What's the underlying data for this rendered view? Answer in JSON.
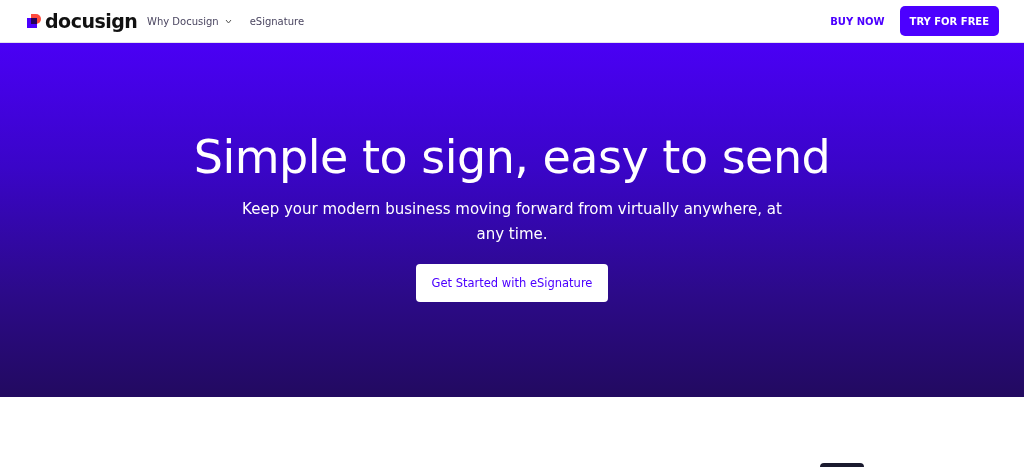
{
  "header": {
    "logo": "docusign",
    "nav": [
      {
        "label": "Why Docusign",
        "kind": "dropdown",
        "expanded": false
      },
      {
        "label": "eSignature",
        "kind": "link"
      }
    ],
    "actions": [
      {
        "label": "BUY NOW",
        "kind": "link"
      },
      {
        "label": "TRY FOR FREE",
        "kind": "primary"
      }
    ]
  },
  "hero": {
    "title": "Simple to sign, easy to send",
    "subtitle": "Keep your modern business moving forward from virtually anywhere, at any time.",
    "button": "Get Started with eSignature"
  }
}
